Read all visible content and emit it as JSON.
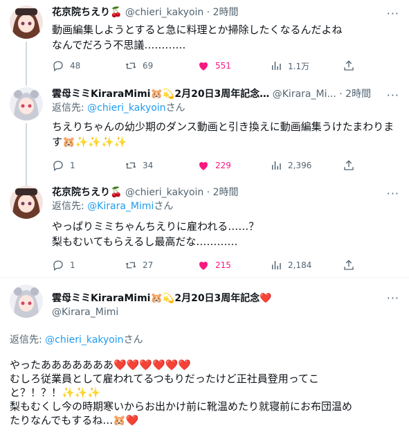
{
  "colors": {
    "accent": "#1d9bf0",
    "like": "#f91880",
    "muted": "#536471"
  },
  "tweets": [
    {
      "name": "花京院ちえり🍒",
      "handle": "@chieri_kakyoin",
      "dot": "·",
      "time": "2時間",
      "replying_prefix": "",
      "replying_to": "",
      "replying_suffix": "",
      "lines": [
        "動画編集しようとすると急に料理とか掃除したくなるんだよね",
        "なんでだろう不思議…………"
      ],
      "replies": "48",
      "retweets": "69",
      "likes": "551",
      "views": "1.1万"
    },
    {
      "name": "雲母ミミKiraraMimi🐹💫2月20日3周年記念…",
      "handle": "@Kirara_Mi...",
      "dot": "·",
      "time": "2時間",
      "replying_prefix": "返信先: ",
      "replying_to": "@chieri_kakyoin",
      "replying_suffix": "さん",
      "lines": [
        "ちえりちゃんの幼少期のダンス動画と引き換えに動画編集うけたまわりま",
        "す🐹✨✨✨✨"
      ],
      "replies": "1",
      "retweets": "34",
      "likes": "229",
      "views": "2,396"
    },
    {
      "name": "花京院ちえり🍒",
      "handle": "@chieri_kakyoin",
      "dot": "·",
      "time": "2時間",
      "replying_prefix": "返信先: ",
      "replying_to": "@Kirara_Mimi",
      "replying_suffix": "さん",
      "lines": [
        "やっぱりミミちゃんちえりに雇われる……？",
        "梨もむいてもらえるし最高だな…………"
      ],
      "replies": "1",
      "retweets": "27",
      "likes": "215",
      "views": "2,184"
    }
  ],
  "main": {
    "name": "雲母ミミKiraraMimi🐹💫2月20日3周年記念❤️",
    "handle": "@Kirara_Mimi",
    "replying_prefix": "返信先: ",
    "replying_to": "@chieri_kakyoin",
    "replying_suffix": "さん",
    "lines": [
      "やったあああああああ❤️❤️❤️❤️❤️❤️",
      "むしろ従業員として雇われてるつもりだったけど正社員登用ってこ",
      "と？！？！✨✨✨",
      "梨もむくし今の時期寒いからお出かけ前に靴温めたり就寝前にお布団温め",
      "たりなんでもするね…🐹❤️"
    ]
  },
  "icons": {
    "more": "more-icon",
    "reply": "reply-icon",
    "retweet": "retweet-icon",
    "like": "heart-icon",
    "views": "views-icon",
    "share": "share-icon"
  },
  "more_glyph": "···"
}
